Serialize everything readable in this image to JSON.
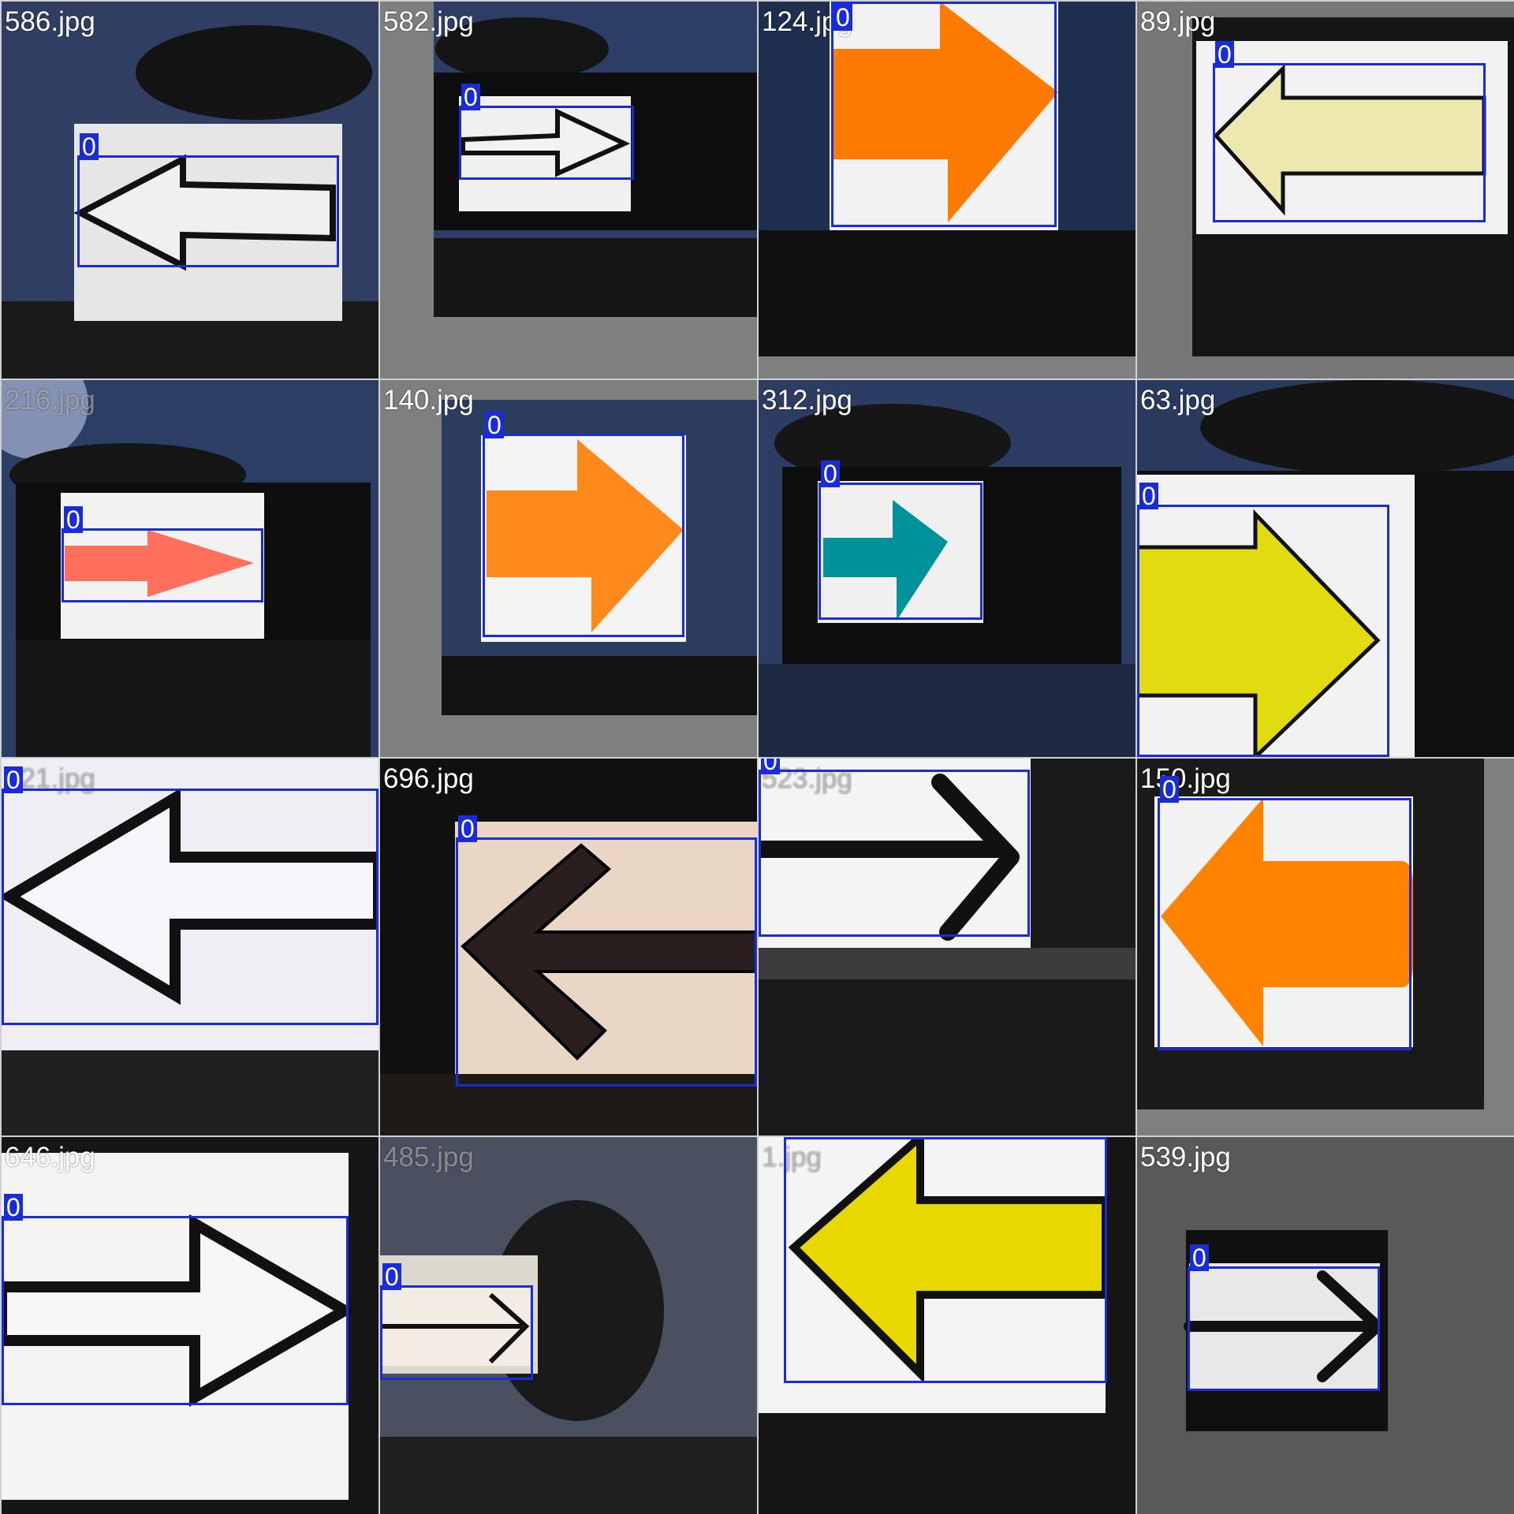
{
  "detection_label": "0",
  "box_color": "#1a2bd8",
  "tiles": [
    {
      "file": "586.jpg",
      "arrow": "left",
      "arrow_color": "#f0f0f0"
    },
    {
      "file": "582.jpg",
      "arrow": "right",
      "arrow_color": "#f0f0f0"
    },
    {
      "file": "124.jpg",
      "arrow": "right",
      "arrow_color": "#ff7a00"
    },
    {
      "file": "89.jpg",
      "arrow": "left",
      "arrow_color": "#e8e4a8"
    },
    {
      "file": "216.jpg",
      "arrow": "right",
      "arrow_color": "#ff6f5c"
    },
    {
      "file": "140.jpg",
      "arrow": "right",
      "arrow_color": "#ff8a1c"
    },
    {
      "file": "312.jpg",
      "arrow": "right",
      "arrow_color": "#00929a"
    },
    {
      "file": "63.jpg",
      "arrow": "right",
      "arrow_color": "#e0dc10"
    },
    {
      "file": "021.jpg",
      "arrow": "left",
      "arrow_color": "#f4f4f8"
    },
    {
      "file": "696.jpg",
      "arrow": "left",
      "arrow_color": "#2a1e1e"
    },
    {
      "file": "523.jpg",
      "arrow": "right",
      "arrow_color": "#111111"
    },
    {
      "file": "150.jpg",
      "arrow": "left",
      "arrow_color": "#ff8200"
    },
    {
      "file": "646.jpg",
      "arrow": "right",
      "arrow_color": "#f4f4f4"
    },
    {
      "file": "485.jpg",
      "arrow": "right",
      "arrow_color": "#f0ece4"
    },
    {
      "file": "1.jpg",
      "arrow": "left",
      "arrow_color": "#e8d800"
    },
    {
      "file": "539.jpg",
      "arrow": "right",
      "arrow_color": "#111111"
    }
  ]
}
